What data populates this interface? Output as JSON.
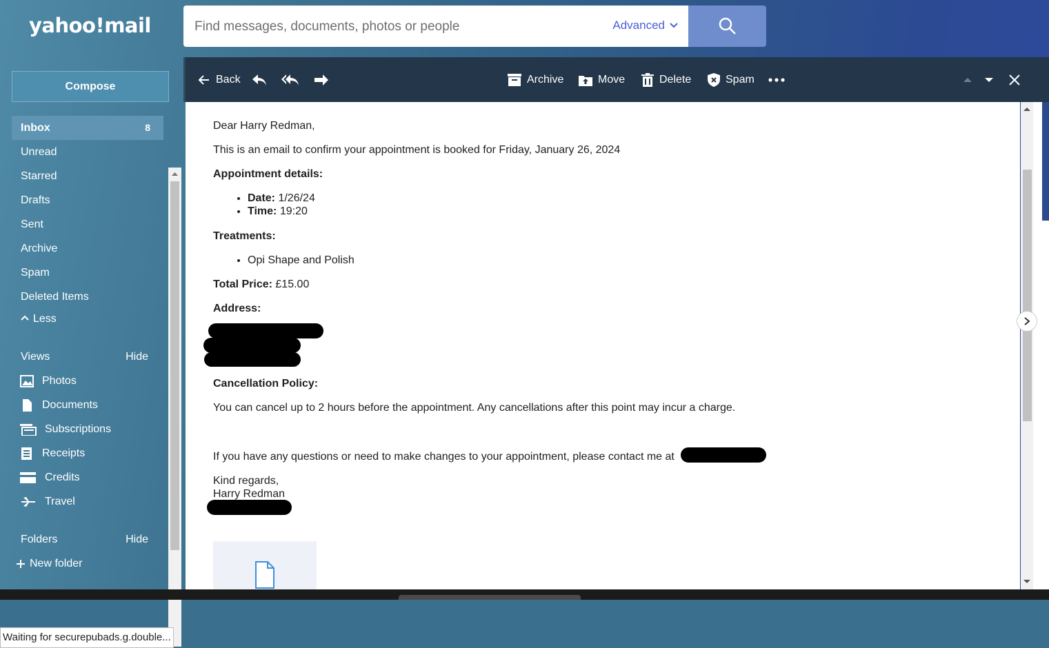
{
  "app": {
    "logo": "yahoo!mail"
  },
  "search": {
    "placeholder": "Find messages, documents, photos or people",
    "advanced_label": "Advanced"
  },
  "compose_label": "Compose",
  "folders_nav": [
    {
      "label": "Inbox",
      "count": "8"
    },
    {
      "label": "Unread"
    },
    {
      "label": "Starred"
    },
    {
      "label": "Drafts"
    },
    {
      "label": "Sent"
    },
    {
      "label": "Archive"
    },
    {
      "label": "Spam"
    },
    {
      "label": "Deleted Items"
    }
  ],
  "less_label": "Less",
  "views": {
    "header": "Views",
    "hide": "Hide",
    "items": [
      {
        "label": "Photos",
        "icon": "photos-icon"
      },
      {
        "label": "Documents",
        "icon": "documents-icon"
      },
      {
        "label": "Subscriptions",
        "icon": "subscriptions-icon"
      },
      {
        "label": "Receipts",
        "icon": "receipts-icon"
      },
      {
        "label": "Credits",
        "icon": "credits-icon"
      },
      {
        "label": "Travel",
        "icon": "travel-icon"
      }
    ]
  },
  "folders": {
    "header": "Folders",
    "hide": "Hide",
    "new_folder": "New folder"
  },
  "status_text": "Waiting for securepubads.g.double...",
  "toolbar": {
    "back": "Back",
    "archive": "Archive",
    "move": "Move",
    "delete": "Delete",
    "spam": "Spam"
  },
  "email": {
    "greeting": "Dear Harry Redman,",
    "intro": "This is an email to confirm your appointment is booked for Friday, January 26, 2024",
    "details_heading": "Appointment details:",
    "date_label": "Date:",
    "date_value": " 1/26/24",
    "time_label": "Time:",
    "time_value": " 19:20",
    "treatments_heading": "Treatments:",
    "treatment_1": "Opi Shape and Polish",
    "total_label": "Total Price:",
    "total_value": " £15.00",
    "address_heading": "Address:",
    "cancellation_heading": "Cancellation Policy:",
    "cancellation_text": "You can cancel up to 2 hours before the appointment. Any cancellations after this point may incur a charge.",
    "contact_text": "If you have any questions or need to make changes to your appointment, please contact me at",
    "signoff": "Kind regards,",
    "signature": "Harry Redman"
  },
  "colors": {
    "accent": "#4a5fd6",
    "toolbar_bg": "#243649",
    "search_button": "#6f8dcc"
  }
}
